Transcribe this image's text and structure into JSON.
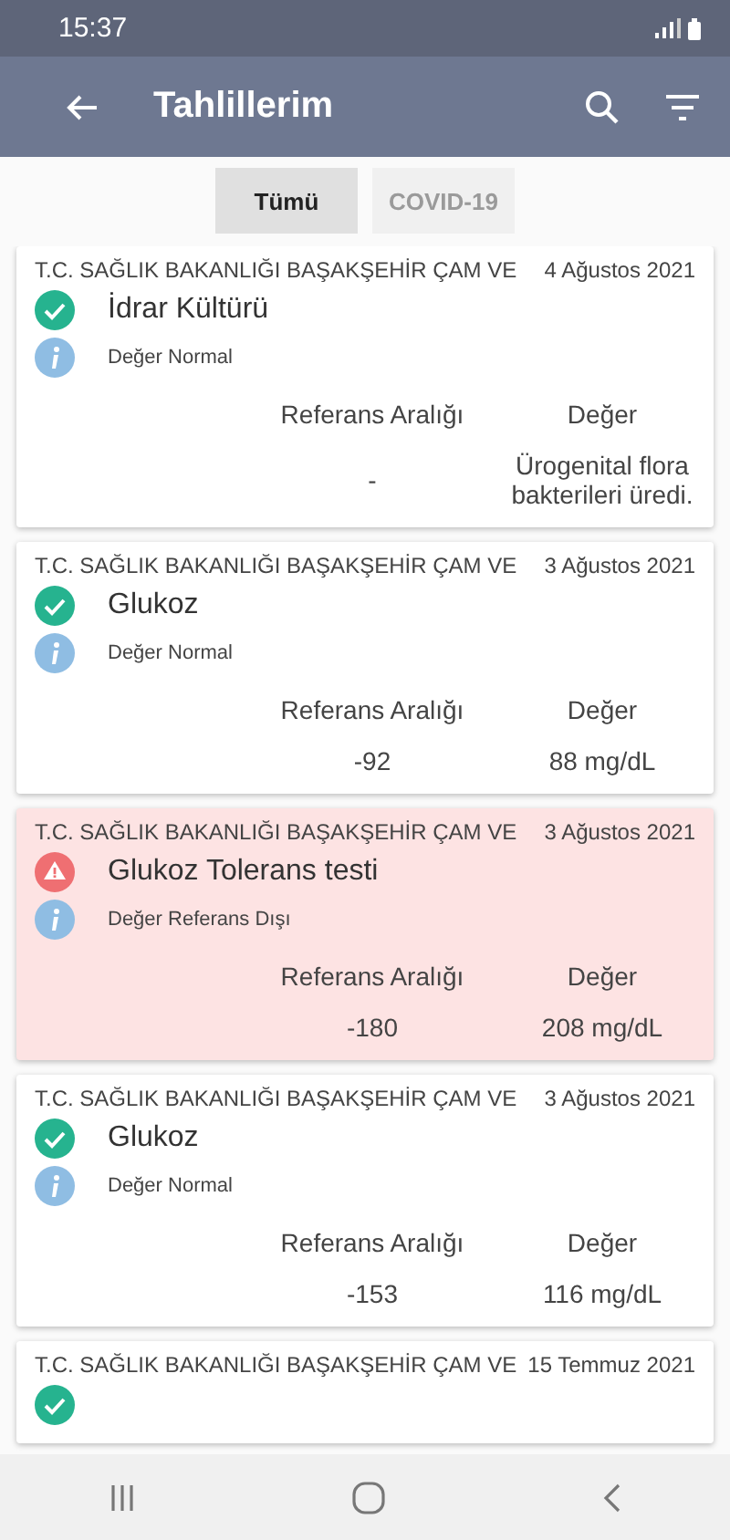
{
  "status_bar": {
    "time": "15:37"
  },
  "app_bar": {
    "title": "Tahlillerim"
  },
  "tabs": [
    {
      "label": "Tümü",
      "selected": true
    },
    {
      "label": "COVID-19",
      "selected": false
    }
  ],
  "results": [
    {
      "institution": "T.C. SAĞLIK BAKANLIĞI BAŞAKŞEHİR ÇAM VE",
      "date": "4 Ağustos 2021",
      "test": "İdrar Kültürü",
      "out_of_range": false,
      "status_text": "Değer Normal",
      "reference_header": "Referans Aralığı",
      "value_header": "Değer",
      "reference": "-",
      "value": "Ürogenital flora bakterileri üredi."
    },
    {
      "institution": "T.C. SAĞLIK BAKANLIĞI BAŞAKŞEHİR ÇAM VE",
      "date": "3 Ağustos 2021",
      "test": "Glukoz",
      "out_of_range": false,
      "status_text": "Değer Normal",
      "reference_header": "Referans Aralığı",
      "value_header": "Değer",
      "reference": "-92",
      "value": "88 mg/dL"
    },
    {
      "institution": "T.C. SAĞLIK BAKANLIĞI BAŞAKŞEHİR ÇAM VE",
      "date": "3 Ağustos 2021",
      "test": "Glukoz Tolerans testi",
      "out_of_range": true,
      "status_text": "Değer Referans Dışı",
      "reference_header": "Referans Aralığı",
      "value_header": "Değer",
      "reference": "-180",
      "value": "208 mg/dL"
    },
    {
      "institution": "T.C. SAĞLIK BAKANLIĞI BAŞAKŞEHİR ÇAM VE",
      "date": "3 Ağustos 2021",
      "test": "Glukoz",
      "out_of_range": false,
      "status_text": "Değer Normal",
      "reference_header": "Referans Aralığı",
      "value_header": "Değer",
      "reference": "-153",
      "value": "116 mg/dL"
    },
    {
      "institution": "T.C. SAĞLIK BAKANLIĞI BAŞAKŞEHİR ÇAM VE",
      "date": "15 Temmuz 2021",
      "out_of_range": false
    }
  ]
}
